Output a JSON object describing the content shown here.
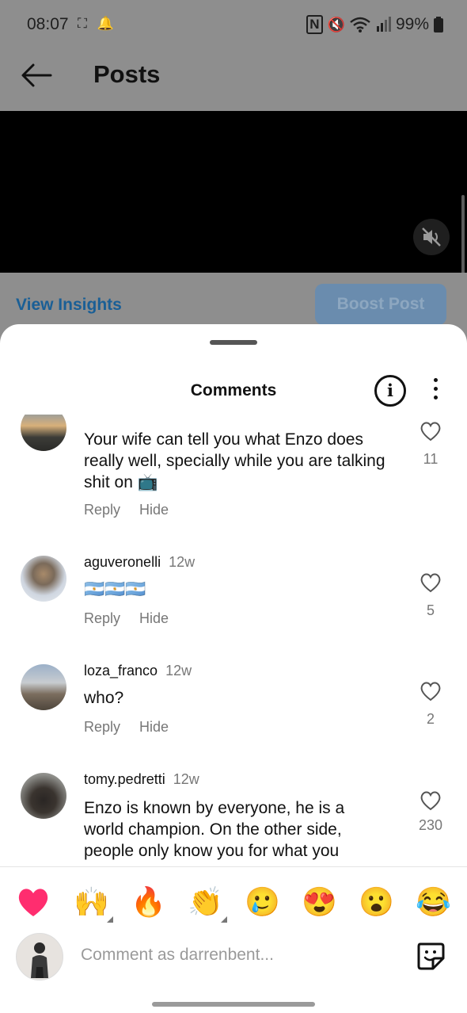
{
  "status_bar": {
    "time": "08:07",
    "battery": "99%",
    "icons": [
      "screenshot-icon",
      "notification-bell-icon",
      "nfc-icon",
      "mute-icon",
      "wifi-icon",
      "signal-icon",
      "battery-icon"
    ]
  },
  "header": {
    "title": "Posts"
  },
  "post": {
    "view_insights_label": "View Insights",
    "boost_label": "Boost Post"
  },
  "comments_sheet": {
    "title": "Comments",
    "comments": [
      {
        "username": "",
        "age": "",
        "text": "Your wife can tell you what Enzo does really well, specially while you are talking shit on 📺",
        "reply_label": "Reply",
        "hide_label": "Hide",
        "likes": "11"
      },
      {
        "username": "aguveronelli",
        "age": "12w",
        "text": "🇦🇷🇦🇷🇦🇷",
        "reply_label": "Reply",
        "hide_label": "Hide",
        "likes": "5"
      },
      {
        "username": "loza_franco",
        "age": "12w",
        "text": "who?",
        "reply_label": "Reply",
        "hide_label": "Hide",
        "likes": "2"
      },
      {
        "username": "tomy.pedretti",
        "age": "12w",
        "text": "Enzo is known by everyone, he is a world champion. On the other side, people only know you for what you",
        "reply_label": "",
        "hide_label": "",
        "likes": "230"
      }
    ],
    "quick_emojis": [
      "❤️",
      "🙌",
      "🔥",
      "👏",
      "🥲",
      "😍",
      "😮",
      "😂"
    ],
    "composer_placeholder": "Comment as darrenbent..."
  },
  "colors": {
    "accent_blue": "#1a5f96",
    "boost_blue": "#6a8cae",
    "heart_red": "#ff2d55"
  }
}
